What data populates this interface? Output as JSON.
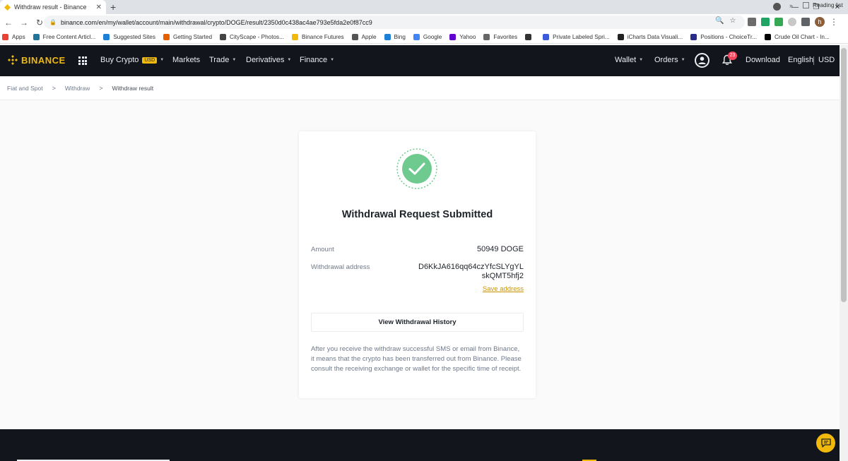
{
  "browser": {
    "tab_title": "Withdraw result - Binance",
    "url": "binance.com/en/my/wallet/account/main/withdrawal/crypto/DOGE/result/2350d0c438ac4ae793e5fda2e0f87cc9",
    "profile_initial": "h",
    "bookmarks": [
      {
        "label": "Apps",
        "color": "#e84335"
      },
      {
        "label": "Free Content Articl...",
        "color": "#21759b"
      },
      {
        "label": "Suggested Sites",
        "color": "#1d7fd6"
      },
      {
        "label": "Getting Started",
        "color": "#e66000"
      },
      {
        "label": "CityScape - Photos...",
        "color": "#444444"
      },
      {
        "label": "Binance Futures",
        "color": "#f0b90b"
      },
      {
        "label": "Apple",
        "color": "#555555"
      },
      {
        "label": "Bing",
        "color": "#1d7fd6"
      },
      {
        "label": "Google",
        "color": "#4285f4"
      },
      {
        "label": "Yahoo",
        "color": "#6001d2"
      },
      {
        "label": "Favorites",
        "color": "#666666"
      },
      {
        "label": "",
        "color": "#333333"
      },
      {
        "label": "Private Labeled Spri...",
        "color": "#3b5bdb"
      },
      {
        "label": "iCharts Data Visuali...",
        "color": "#222222"
      },
      {
        "label": "Positions - ChoiceTr...",
        "color": "#2b2b8c"
      },
      {
        "label": "Crude Oil Chart - In...",
        "color": "#000000"
      }
    ],
    "bookmarks_more": "»",
    "reading_list": "Reading list"
  },
  "header": {
    "logo_text": "BINANCE",
    "buy_crypto": "Buy Crypto",
    "buy_crypto_badge": "USD",
    "markets": "Markets",
    "trade": "Trade",
    "derivatives": "Derivatives",
    "finance": "Finance",
    "wallet": "Wallet",
    "orders": "Orders",
    "notif_count": "23",
    "download": "Download",
    "language": "English",
    "currency": "USD"
  },
  "breadcrumb": {
    "item1": "Fiat and Spot",
    "item2": "Withdraw",
    "current": "Withdraw result"
  },
  "result": {
    "title": "Withdrawal Request Submitted",
    "amount_label": "Amount",
    "amount_value": "50949 DOGE",
    "address_label": "Withdrawal address",
    "address_value": "D6KkJA616qq64czYfcSLYgYLskQMT5hfj2",
    "save_address": "Save address",
    "history_button": "View Withdrawal History",
    "note": "After you receive the withdraw successful SMS or email from Binance, it means that the crypto has been transferred out from Binance. Please consult the receiving exchange or wallet for the specific time of receipt."
  },
  "colors": {
    "brand_yellow": "#f0b90b",
    "success_green": "#6fca8f",
    "header_bg": "#12161c",
    "link_gold": "#c99400"
  }
}
